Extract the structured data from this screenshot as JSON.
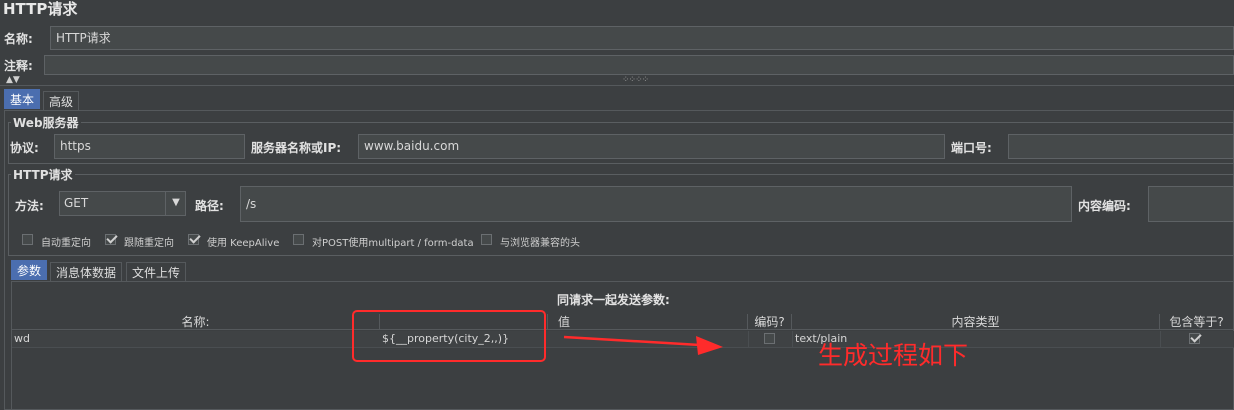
{
  "page_title": "HTTP请求",
  "name": {
    "label": "名称:",
    "value": "HTTP请求"
  },
  "comment": {
    "label": "注释:"
  },
  "tabs_top": [
    {
      "label": "基本"
    },
    {
      "label": "高级"
    }
  ],
  "web_server": {
    "legend": "Web服务器",
    "protocol_label": "协议:",
    "protocol_value": "https",
    "server_label": "服务器名称或IP:",
    "server_value": "www.baidu.com",
    "port_label": "端口号:",
    "port_value": ""
  },
  "http_request": {
    "legend": "HTTP请求",
    "method_label": "方法:",
    "method_value": "GET",
    "path_label": "路径:",
    "path_value": "/s",
    "encoding_label": "内容编码:",
    "encoding_value": ""
  },
  "options": [
    {
      "label": "自动重定向",
      "checked": false
    },
    {
      "label": "跟随重定向",
      "checked": true
    },
    {
      "label": "使用 KeepAlive",
      "checked": true
    },
    {
      "label": "对POST使用multipart / form-data",
      "checked": false
    },
    {
      "label": "与浏览器兼容的头",
      "checked": false
    }
  ],
  "tabs_params": [
    {
      "label": "参数"
    },
    {
      "label": "消息体数据"
    },
    {
      "label": "文件上传"
    }
  ],
  "params_table": {
    "caption": "同请求一起发送参数:",
    "headers": {
      "name": "名称:",
      "value": "值",
      "encode": "编码?",
      "content_type": "内容类型",
      "include_equals": "包含等于?"
    },
    "rows": [
      {
        "name": "wd",
        "value": "${__property(city_2,,)}",
        "encode": false,
        "content_type": "text/plain",
        "include_equals": true
      }
    ]
  },
  "annotation": {
    "text": "生成过程如下",
    "color": "#ff2b2b"
  },
  "colors": {
    "background": "#3c3f41",
    "field": "#45494a",
    "tab_active": "#4b6eaf",
    "annotation": "#ff2b2b"
  }
}
